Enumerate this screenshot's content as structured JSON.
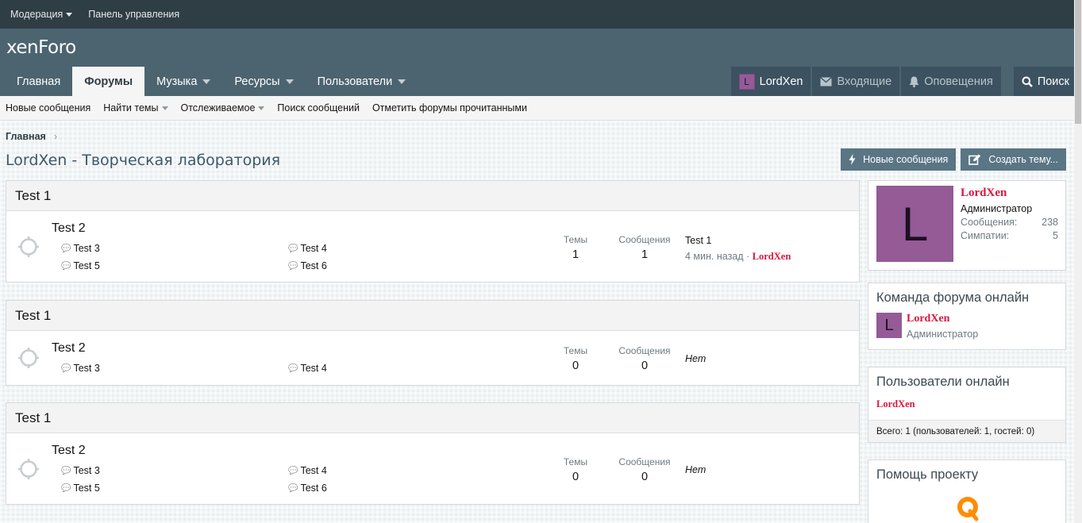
{
  "staffbar": {
    "moderation": "Модерация",
    "control_panel": "Панель управления"
  },
  "logo": "xenForo",
  "nav": {
    "tabs": [
      {
        "label": "Главная",
        "dropdown": false,
        "active": false
      },
      {
        "label": "Форумы",
        "dropdown": false,
        "active": true
      },
      {
        "label": "Музыка",
        "dropdown": true,
        "active": false
      },
      {
        "label": "Ресурсы",
        "dropdown": true,
        "active": false
      },
      {
        "label": "Пользователи",
        "dropdown": true,
        "active": false
      }
    ],
    "user": {
      "initial": "L",
      "name": "LordXen"
    },
    "inbox": "Входящие",
    "alerts": "Оповещения",
    "search": "Поиск"
  },
  "subnav": [
    {
      "label": "Новые сообщения",
      "dropdown": false
    },
    {
      "label": "Найти темы",
      "dropdown": true
    },
    {
      "label": "Отслеживаемое",
      "dropdown": true
    },
    {
      "label": "Поиск сообщений",
      "dropdown": false
    },
    {
      "label": "Отметить форумы прочитанными",
      "dropdown": false
    }
  ],
  "breadcrumb": {
    "home": "Главная",
    "separator": "›"
  },
  "page_title": "LordXen - Творческая лаборатория",
  "actions": {
    "new_posts": "Новые сообщения",
    "create_thread": "Создать тему..."
  },
  "categories": [
    {
      "title": "Test 1",
      "forum": {
        "title": "Test 2",
        "subforums": [
          "Test 3",
          "Test 4",
          "Test 5",
          "Test 6"
        ],
        "threads_label": "Темы",
        "threads": "1",
        "posts_label": "Сообщения",
        "posts": "1",
        "latest": {
          "title": "Test 1",
          "meta": "4 мин. назад ·",
          "user": "LordXen"
        }
      }
    },
    {
      "title": "Test 1",
      "forum": {
        "title": "Test 2",
        "subforums": [
          "Test 3",
          "Test 4"
        ],
        "threads_label": "Темы",
        "threads": "0",
        "posts_label": "Сообщения",
        "posts": "0",
        "none": "Нет"
      }
    },
    {
      "title": "Test 1",
      "forum": {
        "title": "Test 2",
        "subforums": [
          "Test 3",
          "Test 4",
          "Test 5",
          "Test 6"
        ],
        "threads_label": "Темы",
        "threads": "0",
        "posts_label": "Сообщения",
        "posts": "0",
        "none": "Нет"
      }
    }
  ],
  "sidebar": {
    "profile": {
      "initial": "L",
      "name": "LordXen",
      "role": "Администратор",
      "posts_label": "Сообщения:",
      "posts": "238",
      "likes_label": "Симпатии:",
      "likes": "5"
    },
    "staff": {
      "title": "Команда форума онлайн",
      "initial": "L",
      "name": "LordXen",
      "role": "Администратор"
    },
    "online": {
      "title": "Пользователи онлайн",
      "user": "LordXen",
      "total": "Всего: 1 (пользователей: 1, гостей: 0)"
    },
    "donate": {
      "title": "Помощь проекту"
    }
  },
  "colors": {
    "header": "#4b6470",
    "staffbar": "#2f3d44",
    "accent_red": "#d8163c",
    "avatar": "#945b97",
    "button": "#5a7584"
  },
  "icons": [
    "forum-node-icon",
    "subforum-icon",
    "envelope-icon",
    "bell-icon",
    "search-icon",
    "bolt-icon",
    "edit-icon",
    "qiwi-icon"
  ]
}
